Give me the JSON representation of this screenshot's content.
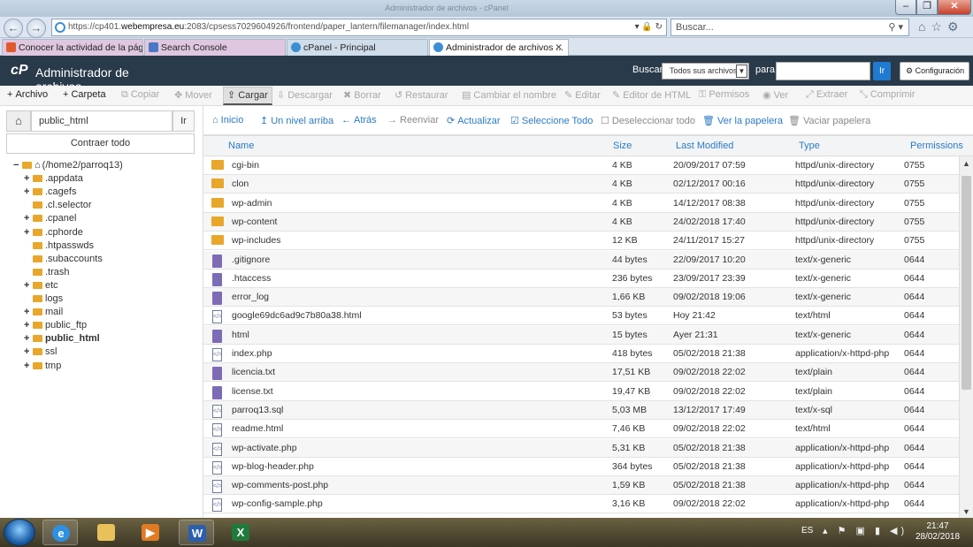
{
  "browser": {
    "window_title": "Administrador de archivos - cPanel",
    "address_host_pre": "https://cp401.",
    "address_host_domain": "webempresa.eu",
    "address_rest": ":2083/cpsess7029604926/frontend/paper_lantern/filemanager/index.html",
    "search_placeholder": "Buscar...",
    "tabs": [
      {
        "label": "Conocer la actividad de la pági...",
        "color": "#e05a2b"
      },
      {
        "label": "Search Console",
        "color": "#4a78c2"
      },
      {
        "label": "cPanel - Principal",
        "color": "#3b8ed3"
      },
      {
        "label": "Administrador de archivos ...",
        "color": "#3b8ed3"
      }
    ]
  },
  "cpanel": {
    "logo": "cP",
    "title": "Administrador de archivos",
    "search_label": "Buscar",
    "search_scope": "Todos sus archivos",
    "para_label": "para",
    "go_label": "Ir",
    "config_label": "Configuración"
  },
  "toolbar": [
    {
      "icon": "+",
      "label": "Archivo",
      "state": "on"
    },
    {
      "icon": "+",
      "label": "Carpeta",
      "state": "on"
    },
    {
      "icon": "⧉",
      "label": "Copiar",
      "state": "off"
    },
    {
      "icon": "✥",
      "label": "Mover",
      "state": "off"
    },
    {
      "icon": "⇪",
      "label": "Cargar",
      "state": "active"
    },
    {
      "icon": "⇩",
      "label": "Descargar",
      "state": "off"
    },
    {
      "icon": "✖",
      "label": "Borrar",
      "state": "off"
    },
    {
      "icon": "↺",
      "label": "Restaurar",
      "state": "off"
    },
    {
      "icon": "▤",
      "label": "Cambiar el nombre",
      "state": "off"
    },
    {
      "icon": "✎",
      "label": "Editar",
      "state": "off"
    },
    {
      "icon": "✎",
      "label": "Editor de HTML",
      "state": "off"
    },
    {
      "icon": "⚿",
      "label": "Permisos",
      "state": "off"
    },
    {
      "icon": "◉",
      "label": "Ver",
      "state": "off"
    },
    {
      "icon": "⤢",
      "label": "Extraer",
      "state": "off"
    },
    {
      "icon": "⤡",
      "label": "Comprimir",
      "state": "off"
    }
  ],
  "sidebar": {
    "path_value": "public_html",
    "go_label": "Ir",
    "collapse_label": "Contraer todo",
    "tree": [
      {
        "toggle": "−",
        "label": "(/home2/parroq13)",
        "level": 0,
        "icon": "home"
      },
      {
        "toggle": "+",
        "label": ".appdata",
        "level": 1
      },
      {
        "toggle": "+",
        "label": ".cagefs",
        "level": 1
      },
      {
        "toggle": "",
        "label": ".cl.selector",
        "level": 1
      },
      {
        "toggle": "+",
        "label": ".cpanel",
        "level": 1
      },
      {
        "toggle": "+",
        "label": ".cphorde",
        "level": 1
      },
      {
        "toggle": "",
        "label": ".htpasswds",
        "level": 1
      },
      {
        "toggle": "",
        "label": ".subaccounts",
        "level": 1
      },
      {
        "toggle": "",
        "label": ".trash",
        "level": 1
      },
      {
        "toggle": "+",
        "label": "etc",
        "level": 1
      },
      {
        "toggle": "",
        "label": "logs",
        "level": 1
      },
      {
        "toggle": "+",
        "label": "mail",
        "level": 1
      },
      {
        "toggle": "+",
        "label": "public_ftp",
        "level": 1
      },
      {
        "toggle": "+",
        "label": "public_html",
        "level": 1,
        "bold": true
      },
      {
        "toggle": "+",
        "label": "ssl",
        "level": 1
      },
      {
        "toggle": "+",
        "label": "tmp",
        "level": 1
      }
    ]
  },
  "filebar": [
    {
      "icon": "⌂",
      "label": "Inicio",
      "state": "on"
    },
    {
      "icon": "↥",
      "label": "Un nivel arriba",
      "state": "on"
    },
    {
      "icon": "←",
      "label": "Atrás",
      "state": "on"
    },
    {
      "icon": "→",
      "label": "Reenviar",
      "state": "off"
    },
    {
      "icon": "⟳",
      "label": "Actualizar",
      "state": "on"
    },
    {
      "icon": "☑",
      "label": "Seleccione Todo",
      "state": "on"
    },
    {
      "icon": "☐",
      "label": "Deseleccionar todo",
      "state": "off"
    },
    {
      "icon": "🗑",
      "label": "Ver la papelera",
      "state": "on"
    },
    {
      "icon": "🗑",
      "label": "Vaciar papelera",
      "state": "off"
    }
  ],
  "table": {
    "headers": {
      "name": "Name",
      "size": "Size",
      "modified": "Last Modified",
      "type": "Type",
      "perm": "Permissions"
    },
    "rows": [
      {
        "icon": "folder",
        "name": "cgi-bin",
        "size": "4 KB",
        "modified": "20/09/2017 07:59",
        "type": "httpd/unix-directory",
        "perm": "0755"
      },
      {
        "icon": "folder",
        "name": "clon",
        "size": "4 KB",
        "modified": "02/12/2017 00:16",
        "type": "httpd/unix-directory",
        "perm": "0755"
      },
      {
        "icon": "folder",
        "name": "wp-admin",
        "size": "4 KB",
        "modified": "14/12/2017 08:38",
        "type": "httpd/unix-directory",
        "perm": "0755"
      },
      {
        "icon": "folder",
        "name": "wp-content",
        "size": "4 KB",
        "modified": "24/02/2018 17:40",
        "type": "httpd/unix-directory",
        "perm": "0755"
      },
      {
        "icon": "folder",
        "name": "wp-includes",
        "size": "12 KB",
        "modified": "24/11/2017 15:27",
        "type": "httpd/unix-directory",
        "perm": "0755"
      },
      {
        "icon": "file",
        "name": ".gitignore",
        "size": "44 bytes",
        "modified": "22/09/2017 10:20",
        "type": "text/x-generic",
        "perm": "0644"
      },
      {
        "icon": "file",
        "name": ".htaccess",
        "size": "236 bytes",
        "modified": "23/09/2017 23:39",
        "type": "text/x-generic",
        "perm": "0644"
      },
      {
        "icon": "file",
        "name": "error_log",
        "size": "1,66 KB",
        "modified": "09/02/2018 19:06",
        "type": "text/x-generic",
        "perm": "0644"
      },
      {
        "icon": "html",
        "name": "google69dc6ad9c7b80a38.html",
        "size": "53 bytes",
        "modified": "Hoy 21:42",
        "type": "text/html",
        "perm": "0644"
      },
      {
        "icon": "file",
        "name": "html",
        "size": "15 bytes",
        "modified": "Ayer 21:31",
        "type": "text/x-generic",
        "perm": "0644"
      },
      {
        "icon": "html",
        "name": "index.php",
        "size": "418 bytes",
        "modified": "05/02/2018 21:38",
        "type": "application/x-httpd-php",
        "perm": "0644"
      },
      {
        "icon": "file",
        "name": "licencia.txt",
        "size": "17,51 KB",
        "modified": "09/02/2018 22:02",
        "type": "text/plain",
        "perm": "0644"
      },
      {
        "icon": "file",
        "name": "license.txt",
        "size": "19,47 KB",
        "modified": "09/02/2018 22:02",
        "type": "text/plain",
        "perm": "0644"
      },
      {
        "icon": "html",
        "name": "parroq13.sql",
        "size": "5,03 MB",
        "modified": "13/12/2017 17:49",
        "type": "text/x-sql",
        "perm": "0644"
      },
      {
        "icon": "html",
        "name": "readme.html",
        "size": "7,46 KB",
        "modified": "09/02/2018 22:02",
        "type": "text/html",
        "perm": "0644"
      },
      {
        "icon": "html",
        "name": "wp-activate.php",
        "size": "5,31 KB",
        "modified": "05/02/2018 21:38",
        "type": "application/x-httpd-php",
        "perm": "0644"
      },
      {
        "icon": "html",
        "name": "wp-blog-header.php",
        "size": "364 bytes",
        "modified": "05/02/2018 21:38",
        "type": "application/x-httpd-php",
        "perm": "0644"
      },
      {
        "icon": "html",
        "name": "wp-comments-post.php",
        "size": "1,59 KB",
        "modified": "05/02/2018 21:38",
        "type": "application/x-httpd-php",
        "perm": "0644"
      },
      {
        "icon": "html",
        "name": "wp-config-sample.php",
        "size": "3,16 KB",
        "modified": "09/02/2018 22:02",
        "type": "application/x-httpd-php",
        "perm": "0644"
      }
    ]
  },
  "taskbar": {
    "lang": "ES",
    "time": "21:47",
    "date": "28/02/2018"
  }
}
